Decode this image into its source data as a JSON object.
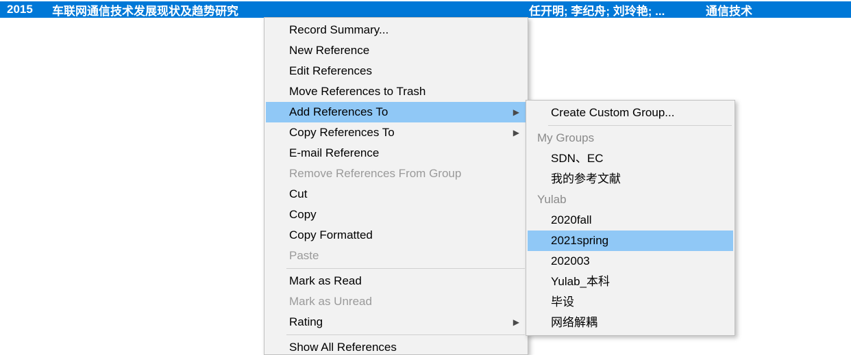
{
  "row": {
    "year": "2015",
    "title": "车联网通信技术发展现状及趋势研究",
    "author": "任开明; 李纪舟; 刘玲艳; ...",
    "journal": "通信技术"
  },
  "menu": {
    "record_summary": "Record Summary...",
    "new_reference": "New Reference",
    "edit_references": "Edit References",
    "move_to_trash": "Move References to Trash",
    "add_references_to": "Add References To",
    "copy_references_to": "Copy References To",
    "email_reference": "E-mail Reference",
    "remove_from_group": "Remove References From Group",
    "cut": "Cut",
    "copy": "Copy",
    "copy_formatted": "Copy Formatted",
    "paste": "Paste",
    "mark_as_read": "Mark as Read",
    "mark_as_unread": "Mark as Unread",
    "rating": "Rating",
    "show_all": "Show All References"
  },
  "submenu": {
    "create_custom_group": "Create Custom Group...",
    "groups": [
      {
        "header": "My Groups",
        "items": [
          "SDN、EC",
          "我的参考文献"
        ]
      },
      {
        "header": "Yulab",
        "items": [
          "2020fall",
          "2021spring",
          "202003",
          "Yulab_本科",
          "毕设",
          "网络解耦"
        ]
      }
    ],
    "highlighted": "2021spring"
  }
}
